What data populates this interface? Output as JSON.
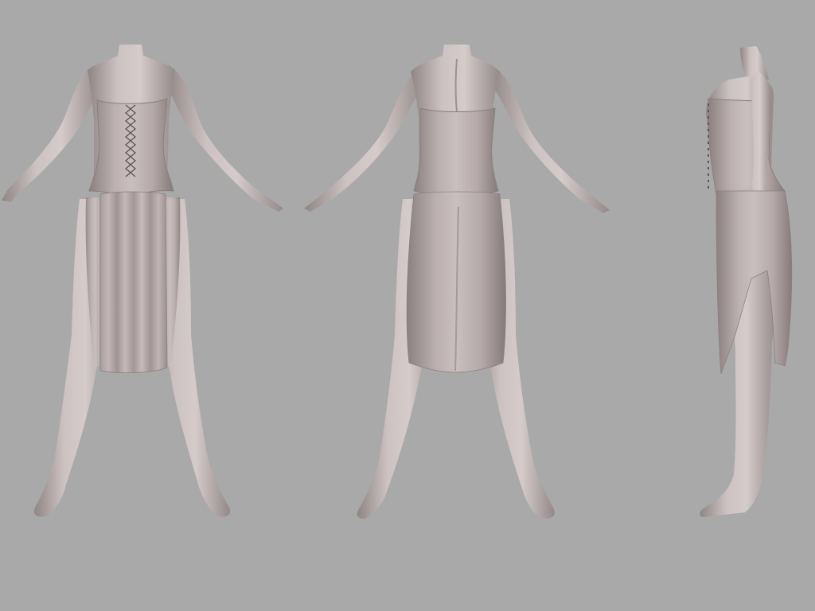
{
  "scene": {
    "background_color": "#a9a9a9",
    "material_color": "#c8bcbc",
    "views": [
      {
        "name": "front-view"
      },
      {
        "name": "back-view"
      },
      {
        "name": "side-view"
      }
    ]
  }
}
